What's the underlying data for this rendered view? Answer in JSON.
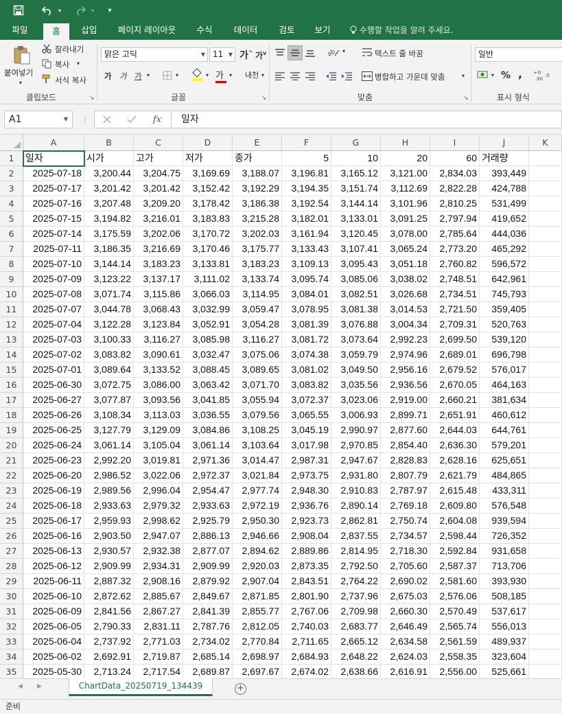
{
  "qat": {
    "save_icon": "save-icon",
    "undo_icon": "undo-icon",
    "redo_icon": "redo-icon",
    "customize_icon": "customize-qat-icon"
  },
  "tabs": [
    "파일",
    "홈",
    "삽입",
    "페이지 레이아웃",
    "수식",
    "데이터",
    "검토",
    "보기"
  ],
  "active_tab": "홈",
  "tell_me": "수행할 작업을 알려 주세요.",
  "ribbon": {
    "clipboard": {
      "paste": "붙여넣기",
      "cut": "잘라내기",
      "copy": "복사",
      "format_painter": "서식 복사",
      "label": "클립보드"
    },
    "font": {
      "name": "맑은 고딕",
      "size": "11",
      "bold": "가",
      "italic": "가",
      "underline": "가",
      "grow": "가",
      "shrink": "가",
      "phonetic": "내천",
      "color_letter": "가",
      "label": "글꼴"
    },
    "alignment": {
      "wrap_text": "텍스트 줄 바꿈",
      "merge_center": "병합하고 가운데 맞춤",
      "label": "맞춤"
    },
    "number": {
      "format": "일반",
      "percent": "%",
      "comma": ",",
      "label": "표시 형식"
    }
  },
  "formula_bar": {
    "name_box": "A1",
    "fx_label": "fx",
    "value": "일자"
  },
  "columns": [
    "A",
    "B",
    "C",
    "D",
    "E",
    "F",
    "G",
    "H",
    "I",
    "J",
    "K"
  ],
  "header_row": [
    "일자",
    "시가",
    "고가",
    "저가",
    "종가",
    "5",
    "10",
    "20",
    "60",
    "거래량"
  ],
  "rows": [
    [
      "2025-07-18",
      "3,200.44",
      "3,204.75",
      "3,169.69",
      "3,188.07",
      "3,196.81",
      "3,165.12",
      "3,121.00",
      "2,834.03",
      "393,449"
    ],
    [
      "2025-07-17",
      "3,201.42",
      "3,201.42",
      "3,152.42",
      "3,192.29",
      "3,194.35",
      "3,151.74",
      "3,112.69",
      "2,822.28",
      "424,788"
    ],
    [
      "2025-07-16",
      "3,207.48",
      "3,209.20",
      "3,178.42",
      "3,186.38",
      "3,192.54",
      "3,144.14",
      "3,101.96",
      "2,810.25",
      "531,499"
    ],
    [
      "2025-07-15",
      "3,194.82",
      "3,216.01",
      "3,183.83",
      "3,215.28",
      "3,182.01",
      "3,133.01",
      "3,091.25",
      "2,797.94",
      "419,652"
    ],
    [
      "2025-07-14",
      "3,175.59",
      "3,202.06",
      "3,170.72",
      "3,202.03",
      "3,161.94",
      "3,120.45",
      "3,078.00",
      "2,785.64",
      "444,036"
    ],
    [
      "2025-07-11",
      "3,186.35",
      "3,216.69",
      "3,170.46",
      "3,175.77",
      "3,133.43",
      "3,107.41",
      "3,065.24",
      "2,773.20",
      "465,292"
    ],
    [
      "2025-07-10",
      "3,144.14",
      "3,183.23",
      "3,133.81",
      "3,183.23",
      "3,109.13",
      "3,095.43",
      "3,051.18",
      "2,760.82",
      "596,572"
    ],
    [
      "2025-07-09",
      "3,123.22",
      "3,137.17",
      "3,111.02",
      "3,133.74",
      "3,095.74",
      "3,085.06",
      "3,038.02",
      "2,748.51",
      "642,961"
    ],
    [
      "2025-07-08",
      "3,071.74",
      "3,115.86",
      "3,066.03",
      "3,114.95",
      "3,084.01",
      "3,082.51",
      "3,026.68",
      "2,734.51",
      "745,793"
    ],
    [
      "2025-07-07",
      "3,044.78",
      "3,068.43",
      "3,032.99",
      "3,059.47",
      "3,078.95",
      "3,081.38",
      "3,014.53",
      "2,721.50",
      "359,405"
    ],
    [
      "2025-07-04",
      "3,122.28",
      "3,123.84",
      "3,052.91",
      "3,054.28",
      "3,081.39",
      "3,076.88",
      "3,004.34",
      "2,709.31",
      "520,763"
    ],
    [
      "2025-07-03",
      "3,100.33",
      "3,116.27",
      "3,085.98",
      "3,116.27",
      "3,081.72",
      "3,073.64",
      "2,992.23",
      "2,699.50",
      "539,120"
    ],
    [
      "2025-07-02",
      "3,083.82",
      "3,090.61",
      "3,032.47",
      "3,075.06",
      "3,074.38",
      "3,059.79",
      "2,974.96",
      "2,689.01",
      "696,798"
    ],
    [
      "2025-07-01",
      "3,089.64",
      "3,133.52",
      "3,088.45",
      "3,089.65",
      "3,081.02",
      "3,049.50",
      "2,956.16",
      "2,679.52",
      "576,017"
    ],
    [
      "2025-06-30",
      "3,072.75",
      "3,086.00",
      "3,063.42",
      "3,071.70",
      "3,083.82",
      "3,035.56",
      "2,936.56",
      "2,670.05",
      "464,163"
    ],
    [
      "2025-06-27",
      "3,077.87",
      "3,093.56",
      "3,041.85",
      "3,055.94",
      "3,072.37",
      "3,023.06",
      "2,919.00",
      "2,660.21",
      "381,634"
    ],
    [
      "2025-06-26",
      "3,108.34",
      "3,113.03",
      "3,036.55",
      "3,079.56",
      "3,065.55",
      "3,006.93",
      "2,899.71",
      "2,651.91",
      "460,612"
    ],
    [
      "2025-06-25",
      "3,127.79",
      "3,129.09",
      "3,084.86",
      "3,108.25",
      "3,045.19",
      "2,990.97",
      "2,877.60",
      "2,644.03",
      "644,761"
    ],
    [
      "2025-06-24",
      "3,061.14",
      "3,105.04",
      "3,061.14",
      "3,103.64",
      "3,017.98",
      "2,970.85",
      "2,854.40",
      "2,636.30",
      "579,201"
    ],
    [
      "2025-06-23",
      "2,992.20",
      "3,019.81",
      "2,971.36",
      "3,014.47",
      "2,987.31",
      "2,947.67",
      "2,828.83",
      "2,628.16",
      "625,651"
    ],
    [
      "2025-06-20",
      "2,986.52",
      "3,022.06",
      "2,972.37",
      "3,021.84",
      "2,973.75",
      "2,931.80",
      "2,807.79",
      "2,621.79",
      "484,865"
    ],
    [
      "2025-06-19",
      "2,989.56",
      "2,996.04",
      "2,954.47",
      "2,977.74",
      "2,948.30",
      "2,910.83",
      "2,787.97",
      "2,615.48",
      "433,311"
    ],
    [
      "2025-06-18",
      "2,933.63",
      "2,979.32",
      "2,933.63",
      "2,972.19",
      "2,936.76",
      "2,890.14",
      "2,769.18",
      "2,609.80",
      "576,548"
    ],
    [
      "2025-06-17",
      "2,959.93",
      "2,998.62",
      "2,925.79",
      "2,950.30",
      "2,923.73",
      "2,862.81",
      "2,750.74",
      "2,604.08",
      "939,594"
    ],
    [
      "2025-06-16",
      "2,903.50",
      "2,947.07",
      "2,886.13",
      "2,946.66",
      "2,908.04",
      "2,837.55",
      "2,734.57",
      "2,598.44",
      "726,352"
    ],
    [
      "2025-06-13",
      "2,930.57",
      "2,932.38",
      "2,877.07",
      "2,894.62",
      "2,889.86",
      "2,814.95",
      "2,718.30",
      "2,592.84",
      "931,658"
    ],
    [
      "2025-06-12",
      "2,909.99",
      "2,934.31",
      "2,909.99",
      "2,920.03",
      "2,873.35",
      "2,792.50",
      "2,705.60",
      "2,587.37",
      "713,706"
    ],
    [
      "2025-06-11",
      "2,887.32",
      "2,908.16",
      "2,879.92",
      "2,907.04",
      "2,843.51",
      "2,764.22",
      "2,690.02",
      "2,581.60",
      "393,930"
    ],
    [
      "2025-06-10",
      "2,872.62",
      "2,885.67",
      "2,849.67",
      "2,871.85",
      "2,801.90",
      "2,737.96",
      "2,675.03",
      "2,576.06",
      "508,185"
    ],
    [
      "2025-06-09",
      "2,841.56",
      "2,867.27",
      "2,841.39",
      "2,855.77",
      "2,767.06",
      "2,709.98",
      "2,660.30",
      "2,570.49",
      "537,617"
    ],
    [
      "2025-06-05",
      "2,790.33",
      "2,831.11",
      "2,787.76",
      "2,812.05",
      "2,740.03",
      "2,683.77",
      "2,646.49",
      "2,565.74",
      "556,013"
    ],
    [
      "2025-06-04",
      "2,737.92",
      "2,771.03",
      "2,734.02",
      "2,770.84",
      "2,711.65",
      "2,665.12",
      "2,634.58",
      "2,561.59",
      "489,937"
    ],
    [
      "2025-06-02",
      "2,692.91",
      "2,719.87",
      "2,685.14",
      "2,698.97",
      "2,684.93",
      "2,648.22",
      "2,624.03",
      "2,558.35",
      "323,604"
    ],
    [
      "2025-05-30",
      "2,713.24",
      "2,717.54",
      "2,689.87",
      "2,697.67",
      "2,674.02",
      "2,638.66",
      "2,616.91",
      "2,556.00",
      "525,661"
    ]
  ],
  "sheet_tab": "ChartData_20250719_134439",
  "status": "준비",
  "accent_color": "#217346"
}
